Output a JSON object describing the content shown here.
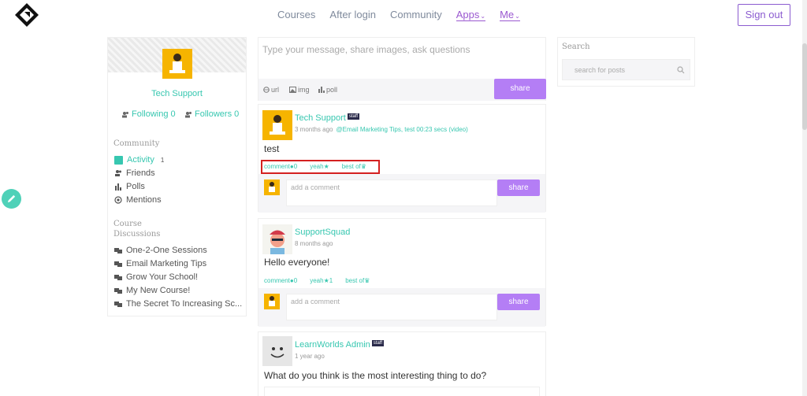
{
  "header": {
    "nav": [
      "Courses",
      "After login",
      "Community"
    ],
    "nav_dropdowns": [
      "Apps",
      "Me"
    ],
    "signout": "Sign out"
  },
  "profile": {
    "name": "Tech Support",
    "following": "Following 0",
    "followers": "Followers 0"
  },
  "community": {
    "title": "Community",
    "items": [
      {
        "label": "Activity",
        "count": "1"
      },
      {
        "label": "Friends"
      },
      {
        "label": "Polls"
      },
      {
        "label": "Mentions"
      }
    ]
  },
  "discussions": {
    "title": "Course Discussions",
    "items": [
      "One-2-One Sessions",
      "Email Marketing Tips",
      "Grow Your School!",
      "My New Course!",
      "The Secret To Increasing Sc..."
    ]
  },
  "composer": {
    "placeholder": "Type your message, share images, ask questions",
    "tools": [
      "url",
      "img",
      "poll"
    ],
    "share": "share"
  },
  "posts": [
    {
      "author": "Tech Support",
      "staff": "staff",
      "time": "3 months ago",
      "context": "@Email Marketing Tips, test 00:23 secs (video)",
      "body": "test",
      "comment": "comment",
      "comment_count": "0",
      "yeah": "yeah",
      "yeah_count": "",
      "best": "best of",
      "add_comment": "add a comment",
      "share": "share"
    },
    {
      "author": "SupportSquad",
      "time": "8 months ago",
      "body": "Hello everyone!",
      "comment": "comment",
      "comment_count": "0",
      "yeah": "yeah",
      "yeah_count": "1",
      "best": "best of",
      "add_comment": "add a comment",
      "share": "share"
    },
    {
      "author": "LearnWorlds Admin",
      "staff": "staff",
      "time": "1 year ago",
      "body": "What do you think is the most interesting thing to do?"
    }
  ],
  "search": {
    "title": "Search",
    "placeholder": "search for posts"
  },
  "colors": {
    "accent": "#37c7b0",
    "purple": "#b47ef5",
    "highlight": "#d42020"
  }
}
